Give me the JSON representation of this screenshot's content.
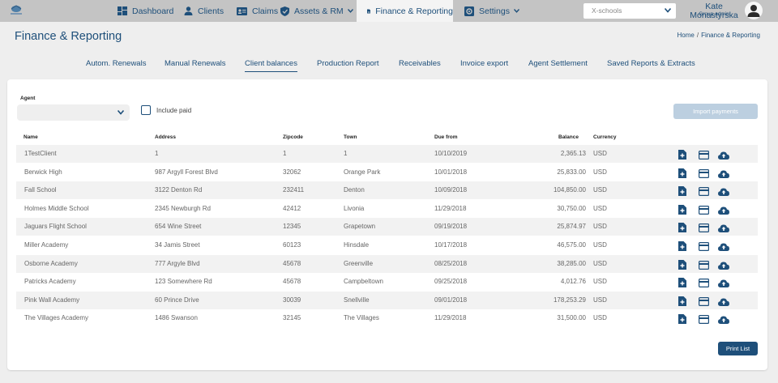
{
  "nav": {
    "items": [
      {
        "label": "Dashboard",
        "icon": "dashboard-icon"
      },
      {
        "label": "Clients",
        "icon": "person-icon"
      },
      {
        "label": "Claims",
        "icon": "id-card-icon"
      },
      {
        "label": "Assets & RM",
        "icon": "shield-icon"
      },
      {
        "label": "Finance & Reporting",
        "icon": "document-icon"
      },
      {
        "label": "Settings",
        "icon": "settings-icon"
      }
    ],
    "active": "Finance & Reporting",
    "school_select": "X-schools",
    "user_name": "Kate Monastyrska",
    "user_role": "Group admin"
  },
  "page": {
    "title": "Finance & Reporting",
    "breadcrumb": {
      "home": "Home",
      "separator": "/",
      "current": "Finance & Reporting"
    }
  },
  "subtabs": {
    "items": [
      "Autom. Renewals",
      "Manual Renewals",
      "Client balances",
      "Production Report",
      "Receivables",
      "Invoice export",
      "Agent Settlement",
      "Saved Reports & Extracts"
    ],
    "active": "Client balances"
  },
  "filters": {
    "agent_label": "Agent",
    "agent_value": "",
    "include_paid_label": "Include paid",
    "include_paid_checked": false,
    "import_button": "Import payments"
  },
  "table": {
    "columns": [
      "Name",
      "Address",
      "Zipcode",
      "Town",
      "Due from",
      "Balance",
      "Currency"
    ],
    "rows": [
      {
        "name": "1TestClient",
        "address": "1",
        "zipcode": "1",
        "town": "1",
        "due_from": "10/10/2019",
        "balance": "2,365.13",
        "currency": "USD"
      },
      {
        "name": "Berwick High",
        "address": "987 Argyll Forest Blvd",
        "zipcode": "32062",
        "town": "Orange Park",
        "due_from": "10/01/2018",
        "balance": "25,833.00",
        "currency": "USD"
      },
      {
        "name": "Fall School",
        "address": "3122 Denton Rd",
        "zipcode": "232411",
        "town": "Denton",
        "due_from": "10/09/2018",
        "balance": "104,850.00",
        "currency": "USD"
      },
      {
        "name": "Holmes Middle School",
        "address": "2345 Newburgh Rd",
        "zipcode": "42412",
        "town": "Livonia",
        "due_from": "11/29/2018",
        "balance": "30,750.00",
        "currency": "USD"
      },
      {
        "name": "Jaguars Flight School",
        "address": "654 Wine Street",
        "zipcode": "12345",
        "town": "Grapetown",
        "due_from": "09/19/2018",
        "balance": "25,874.97",
        "currency": "USD"
      },
      {
        "name": "Miller Academy",
        "address": "34 Jamis Street",
        "zipcode": "60123",
        "town": "Hinsdale",
        "due_from": "10/17/2018",
        "balance": "46,575.00",
        "currency": "USD"
      },
      {
        "name": "Osborne Academy",
        "address": "777 Argyle Blvd",
        "zipcode": "45678",
        "town": "Greenville",
        "due_from": "08/25/2018",
        "balance": "38,285.00",
        "currency": "USD"
      },
      {
        "name": "Patricks Academy",
        "address": "123 Somewhere Rd",
        "zipcode": "45678",
        "town": "Campbeltown",
        "due_from": "09/25/2018",
        "balance": "4,012.76",
        "currency": "USD"
      },
      {
        "name": "Pink Wall Academy",
        "address": "60 Prince Drive",
        "zipcode": "30039",
        "town": "Snellville",
        "due_from": "09/01/2018",
        "balance": "178,253.29",
        "currency": "USD"
      },
      {
        "name": "The Villages Academy",
        "address": "1486 Swanson",
        "zipcode": "32145",
        "town": "The Villages",
        "due_from": "11/29/2018",
        "balance": "31,500.00",
        "currency": "USD"
      }
    ],
    "row_actions": [
      "add-document-icon",
      "credit-card-icon",
      "cloud-upload-icon"
    ]
  },
  "print_button": "Print List",
  "colors": {
    "primary": "#1e4f7a",
    "topbar": "#c4c4c4",
    "disabled_button": "#bccfe0",
    "stripe": "#f2f2f2"
  }
}
